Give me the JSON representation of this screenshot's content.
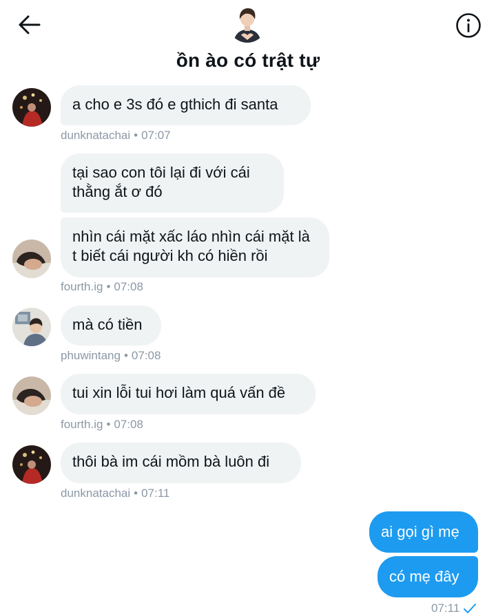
{
  "header": {
    "back_icon": "arrow-left-icon",
    "info_icon": "info-circle-icon",
    "title": "ồn ào có trật tự"
  },
  "messages": [
    {
      "text": "a cho e 3s đó e gthich đi santa",
      "user": "dunknatachai",
      "time": "07:07"
    },
    {
      "text": "tại sao con tôi lại đi với cái thằng ắt ơ đó"
    },
    {
      "text": "nhìn cái mặt xấc láo nhìn cái mặt là t biết cái người kh có hiền rồi",
      "user": "fourth.ig",
      "time": "07:08"
    },
    {
      "text": "mà có tiền",
      "user": "phuwintang",
      "time": "07:08"
    },
    {
      "text": "tui xin lỗi tui hơi làm quá vấn đề",
      "user": "fourth.ig",
      "time": "07:08"
    },
    {
      "text": "thôi bà im cái mồm bà luôn đi",
      "user": "dunknatachai",
      "time": "07:11"
    }
  ],
  "sent": [
    {
      "text": "ai gọi gì mẹ"
    },
    {
      "text": "có mẹ đây"
    }
  ],
  "sent_meta": {
    "time": "07:11",
    "status_icon": "checkmark-icon"
  },
  "colors": {
    "accent": "#1d9bf0",
    "bubble": "#eff3f4",
    "meta": "#8b98a5"
  }
}
